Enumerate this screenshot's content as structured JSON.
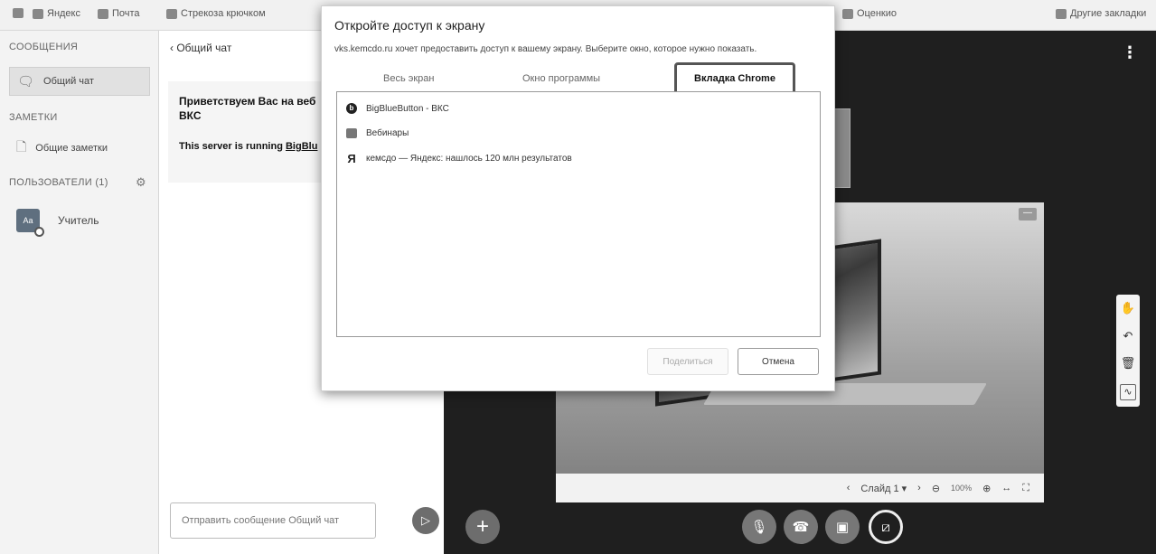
{
  "bookmarks": {
    "items": [
      {
        "label": "Яндекс"
      },
      {
        "label": "Почта"
      },
      {
        "label": "Стрекоза крючком"
      },
      {
        "label": "Оценкио"
      },
      {
        "label": "Другие закладки"
      }
    ]
  },
  "sidebar": {
    "messages_title": "СООБЩЕНИЯ",
    "public_chat": "Общий чат",
    "notes_title": "ЗАМЕТКИ",
    "shared_notes": "Общие заметки",
    "users_title": "ПОЛЬЗОВАТЕЛИ (1)",
    "user_name": "Учитель",
    "user_initials": "Аa"
  },
  "chat": {
    "back_label": "Общий чат",
    "welcome_line1": "Приветствуем Вас на веб",
    "welcome_line2": "ВКС",
    "running_prefix": "This server is running ",
    "running_link": "BigBlu",
    "input_placeholder": "Отправить сообщение Общий чат"
  },
  "presentation": {
    "slide_label": "Слайд 1",
    "zoom": "100%"
  },
  "dialog": {
    "title": "Откройте доступ к экрану",
    "description": "vks.kemcdo.ru хочет предоставить доступ к вашему экрану. Выберите окно, которое нужно показать.",
    "tabs": [
      "Весь экран",
      "Окно программы",
      "Вкладка Chrome"
    ],
    "items": [
      {
        "label": "BigBlueButton - ВКС",
        "icon": "bigbluebutton-icon"
      },
      {
        "label": "Вебинары",
        "icon": "webinar-icon"
      },
      {
        "label": "кемсдо — Яндекс: нашлось 120 млн результатов",
        "icon": "yandex-icon"
      }
    ],
    "share_label": "Поделиться",
    "cancel_label": "Отмена"
  },
  "colors": {
    "main_bg": "#1f1f1f",
    "sidebar_bg": "#f3f3f3",
    "accent_border": "#555555"
  }
}
